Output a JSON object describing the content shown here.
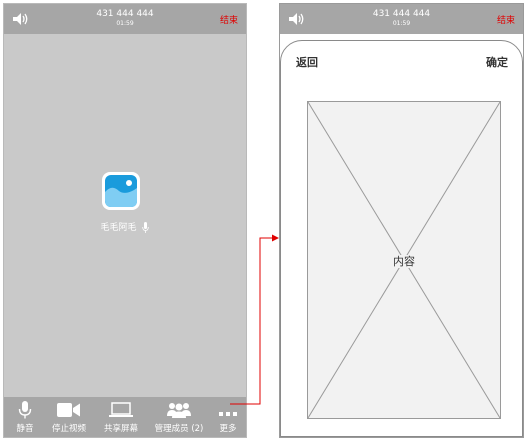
{
  "left_screen": {
    "status": {
      "number": "431 444 444",
      "time": "01:59",
      "end_label": "结束"
    },
    "participant_name": "毛毛阿毛",
    "toolbar": [
      {
        "id": "mute",
        "label": "静音",
        "icon": "microphone-icon"
      },
      {
        "id": "stop-video",
        "label": "停止视频",
        "icon": "video-camera-icon"
      },
      {
        "id": "share-screen",
        "label": "共享屏幕",
        "icon": "laptop-icon"
      },
      {
        "id": "manage-members",
        "label": "管理成员 (2)",
        "icon": "members-icon"
      },
      {
        "id": "more",
        "label": "更多",
        "icon": "more-dots-icon"
      }
    ]
  },
  "right_screen": {
    "status": {
      "number": "431 444 444",
      "time": "01:59",
      "end_label": "结束"
    },
    "back_label": "返回",
    "confirm_label": "确定",
    "content_label": "内容"
  },
  "colors": {
    "status_bar": "#a6a6a6",
    "screen_bg": "#c9c9c9",
    "end_text": "#e00000",
    "avatar_blue": "#1a9bdc",
    "connector": "#e00000"
  }
}
